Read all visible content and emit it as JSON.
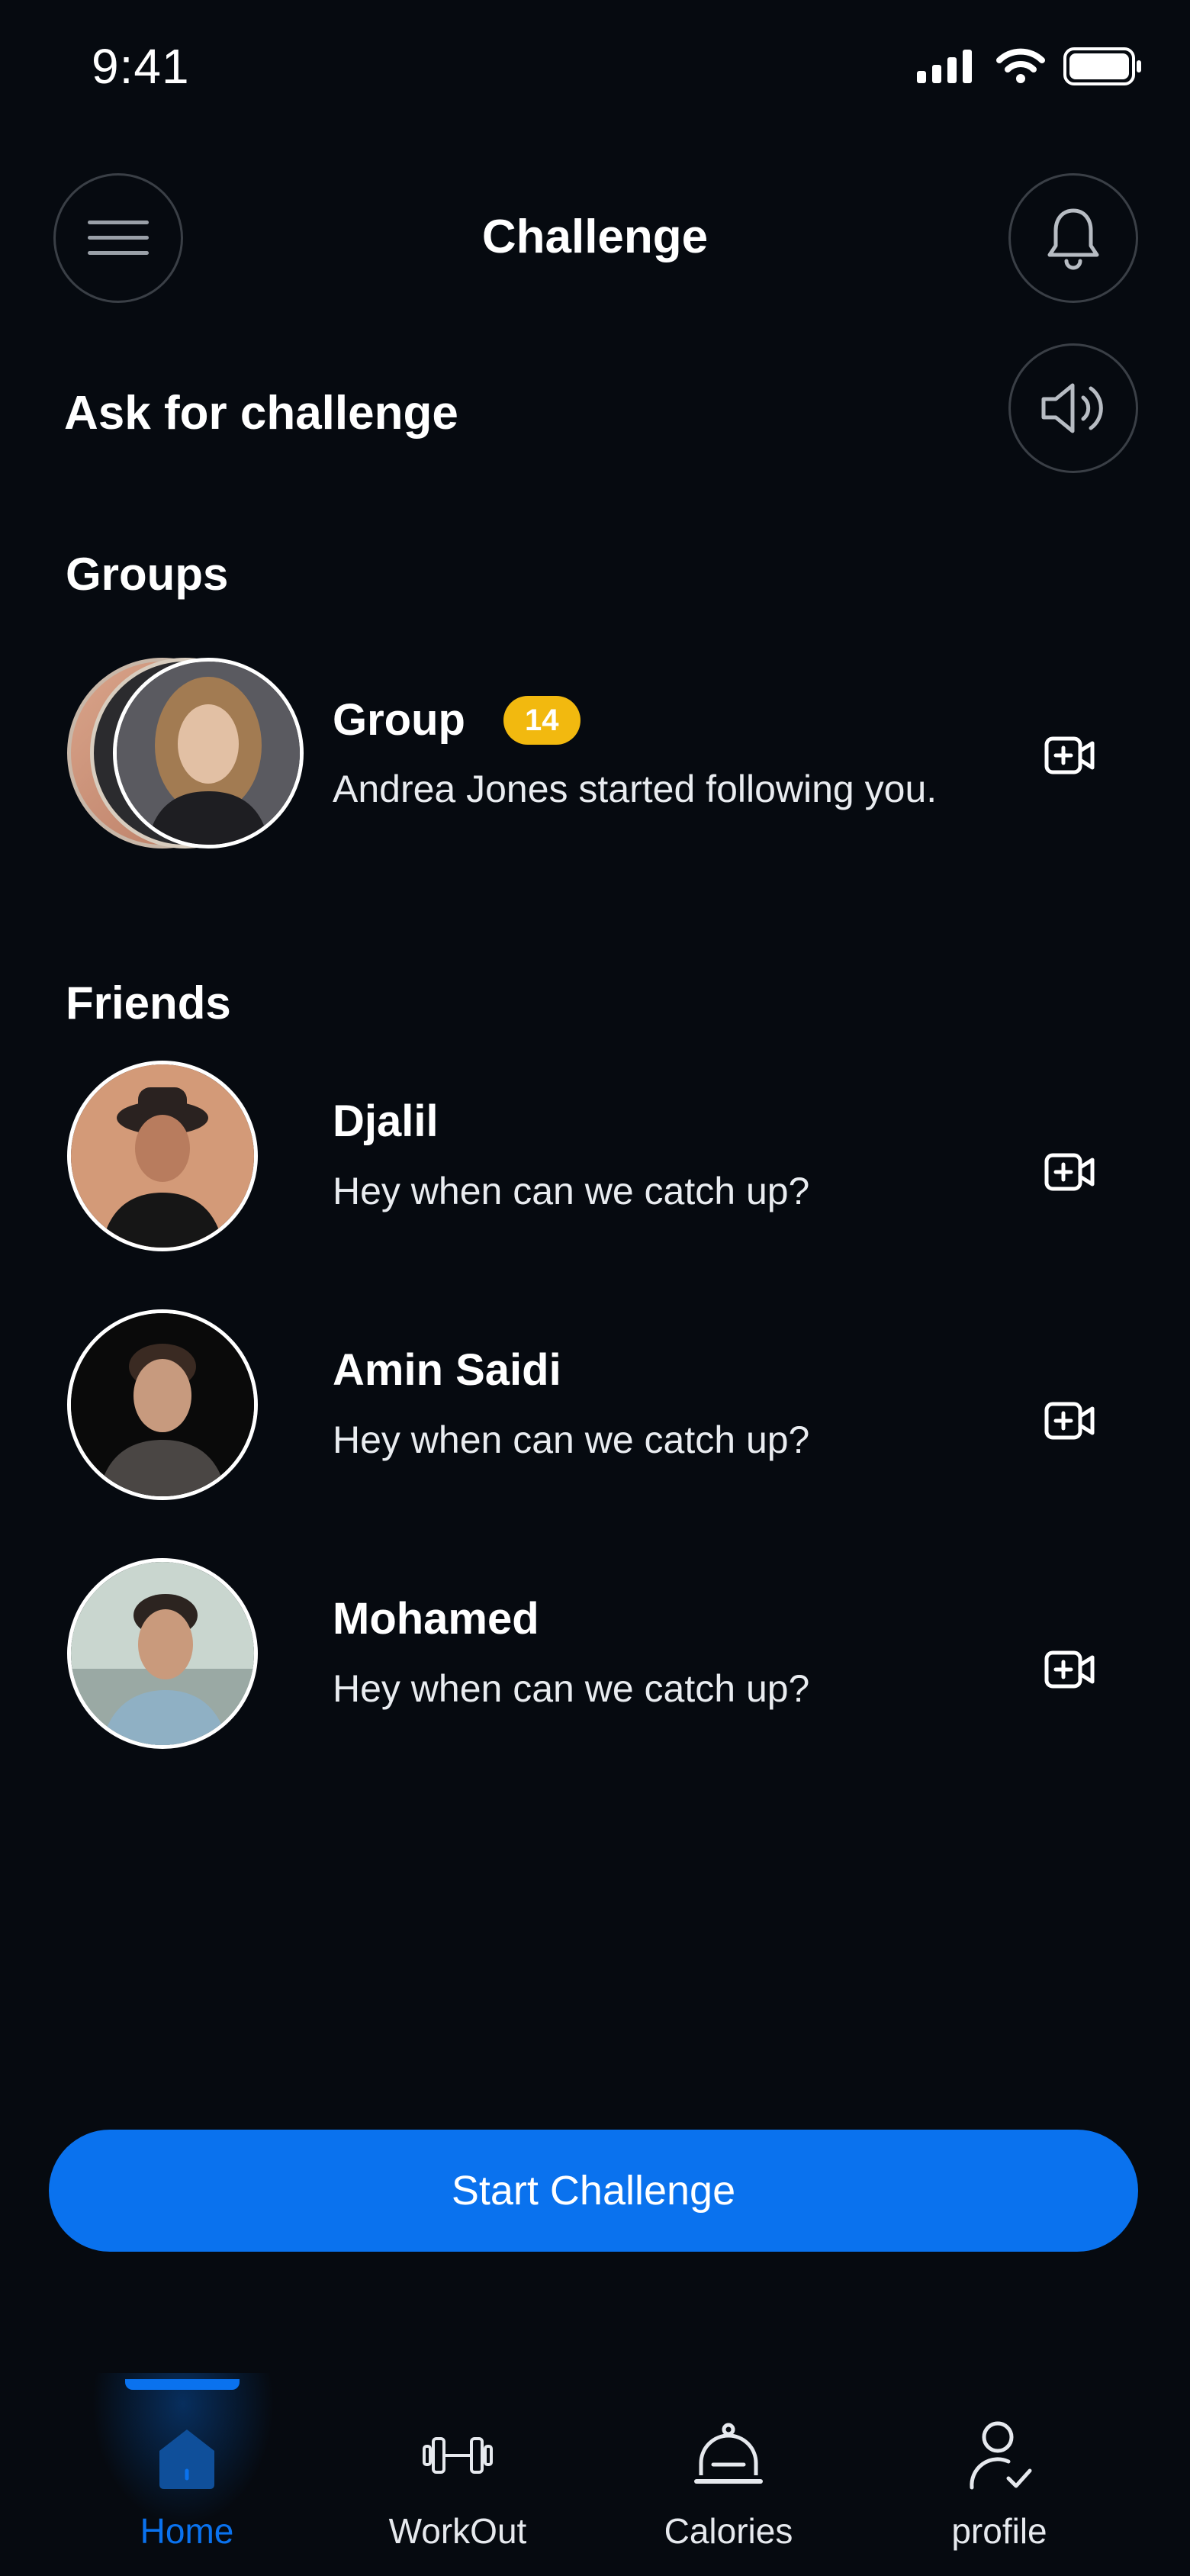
{
  "status_bar": {
    "time": "9:41"
  },
  "header": {
    "title": "Challenge"
  },
  "ask": {
    "label": "Ask for challenge"
  },
  "groups": {
    "title": "Groups",
    "items": [
      {
        "name": "Group",
        "badge": "14",
        "message": "Andrea Jones started following you."
      }
    ]
  },
  "friends": {
    "title": "Friends",
    "items": [
      {
        "name": "Djalil",
        "message": "Hey when can we catch up?"
      },
      {
        "name": "Amin Saidi",
        "message": "Hey when can we catch up?"
      },
      {
        "name": "Mohamed",
        "message": "Hey when can we catch up?"
      }
    ]
  },
  "cta": {
    "label": "Start Challenge"
  },
  "nav": {
    "items": [
      {
        "label": "Home",
        "icon": "home-icon",
        "active": true
      },
      {
        "label": "WorkOut",
        "icon": "dumbbell-icon",
        "active": false
      },
      {
        "label": "Calories",
        "icon": "cloche-icon",
        "active": false
      },
      {
        "label": "profile",
        "icon": "user-check-icon",
        "active": false
      }
    ]
  },
  "colors": {
    "background": "#060a10",
    "accent": "#0a72ee",
    "badge": "#f2b90f"
  }
}
